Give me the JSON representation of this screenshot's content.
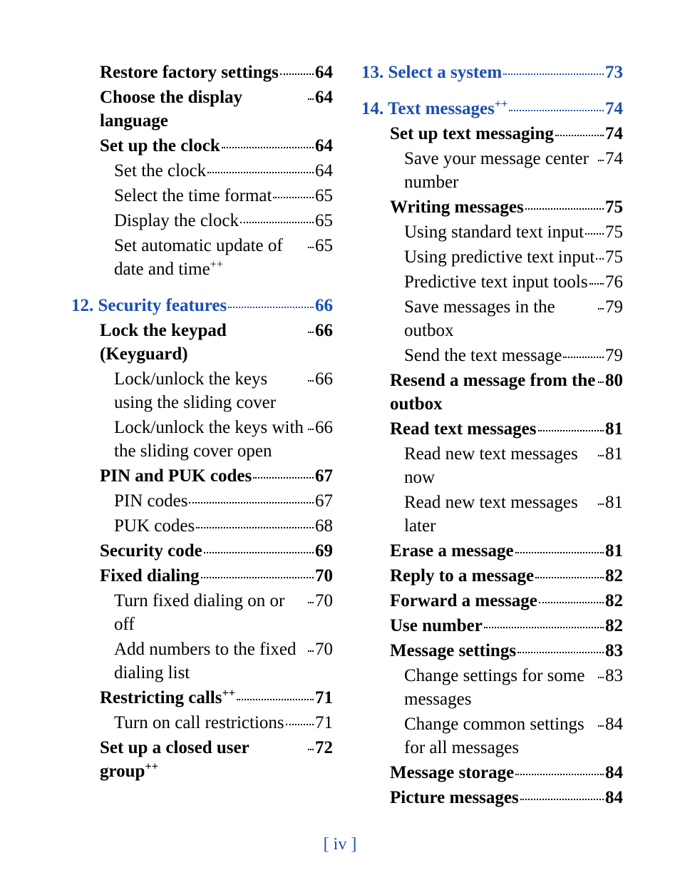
{
  "footer": "[ iv ]",
  "toc": [
    {
      "label": "Restore factory settings",
      "suffix": "",
      "page": "64",
      "level": 1,
      "style": "bold"
    },
    {
      "label": "Choose the display language",
      "suffix": "",
      "page": "64",
      "level": 1,
      "style": "bold"
    },
    {
      "label": "Set up the clock",
      "suffix": "",
      "page": "64",
      "level": 1,
      "style": "bold"
    },
    {
      "label": "Set the clock",
      "suffix": "",
      "page": "64",
      "level": 2,
      "style": "normal"
    },
    {
      "label": "Select the time format",
      "suffix": "",
      "page": "65",
      "level": 2,
      "style": "normal"
    },
    {
      "label": "Display the clock",
      "suffix": "",
      "page": "65",
      "level": 2,
      "style": "normal"
    },
    {
      "label": "Set automatic update of date and time",
      "suffix": "++",
      "page": "65",
      "level": 2,
      "style": "normal"
    },
    {
      "label": "12. Security features",
      "suffix": "",
      "page": "66",
      "level": 0,
      "style": "chapter"
    },
    {
      "label": "Lock the keypad (Keyguard)",
      "suffix": "",
      "page": "66",
      "level": 1,
      "style": "bold"
    },
    {
      "label": "Lock/unlock the keys using the sliding cover",
      "suffix": "",
      "page": "66",
      "level": 2,
      "style": "normal"
    },
    {
      "label": "Lock/unlock the keys with the sliding cover open",
      "suffix": "",
      "page": "66",
      "level": 2,
      "style": "normal"
    },
    {
      "label": "PIN and PUK codes",
      "suffix": "",
      "page": "67",
      "level": 1,
      "style": "bold"
    },
    {
      "label": "PIN codes",
      "suffix": "",
      "page": "67",
      "level": 2,
      "style": "normal"
    },
    {
      "label": "PUK codes",
      "suffix": "",
      "page": "68",
      "level": 2,
      "style": "normal"
    },
    {
      "label": "Security code",
      "suffix": "",
      "page": "69",
      "level": 1,
      "style": "bold"
    },
    {
      "label": "Fixed dialing",
      "suffix": "",
      "page": "70",
      "level": 1,
      "style": "bold"
    },
    {
      "label": "Turn fixed dialing on or off",
      "suffix": "",
      "page": "70",
      "level": 2,
      "style": "normal"
    },
    {
      "label": "Add numbers to the fixed dialing list",
      "suffix": "",
      "page": "70",
      "level": 2,
      "style": "normal"
    },
    {
      "label": "Restricting calls",
      "suffix": "++",
      "page": "71",
      "level": 1,
      "style": "bold"
    },
    {
      "label": "Turn on call restrictions",
      "suffix": "",
      "page": "71",
      "level": 2,
      "style": "normal"
    },
    {
      "label": "Set up a closed user group",
      "suffix": "++",
      "page": "72",
      "level": 1,
      "style": "bold"
    },
    {
      "label": "13. Select a system",
      "suffix": "",
      "page": "73",
      "level": 0,
      "style": "chapter"
    },
    {
      "label": "14. Text messages",
      "suffix": "++",
      "page": "74",
      "level": 0,
      "style": "chapter"
    },
    {
      "label": "Set up text messaging",
      "suffix": "",
      "page": "74",
      "level": 1,
      "style": "bold"
    },
    {
      "label": "Save your message center number",
      "suffix": "",
      "page": "74",
      "level": 2,
      "style": "normal"
    },
    {
      "label": "Writing messages",
      "suffix": "",
      "page": "75",
      "level": 1,
      "style": "bold"
    },
    {
      "label": "Using standard text input",
      "suffix": "",
      "page": "75",
      "level": 2,
      "style": "normal"
    },
    {
      "label": "Using predictive text input",
      "suffix": "",
      "page": "75",
      "level": 2,
      "style": "normal"
    },
    {
      "label": "Predictive text input tools",
      "suffix": "",
      "page": "76",
      "level": 2,
      "style": "normal"
    },
    {
      "label": "Save messages in the outbox",
      "suffix": "",
      "page": "79",
      "level": 2,
      "style": "normal"
    },
    {
      "label": "Send the text message",
      "suffix": "",
      "page": "79",
      "level": 2,
      "style": "normal"
    },
    {
      "label": "Resend a message from the outbox",
      "suffix": "",
      "page": "80",
      "level": 1,
      "style": "bold"
    },
    {
      "label": "Read text messages",
      "suffix": "",
      "page": "81",
      "level": 1,
      "style": "bold"
    },
    {
      "label": "Read new text messages now",
      "suffix": "",
      "page": "81",
      "level": 2,
      "style": "normal"
    },
    {
      "label": "Read new text messages later",
      "suffix": "",
      "page": "81",
      "level": 2,
      "style": "normal"
    },
    {
      "label": "Erase a message",
      "suffix": "",
      "page": "81",
      "level": 1,
      "style": "bold"
    },
    {
      "label": "Reply to a message",
      "suffix": "",
      "page": "82",
      "level": 1,
      "style": "bold"
    },
    {
      "label": "Forward a message",
      "suffix": "",
      "page": "82",
      "level": 1,
      "style": "bold"
    },
    {
      "label": "Use number",
      "suffix": "",
      "page": "82",
      "level": 1,
      "style": "bold"
    },
    {
      "label": "Message settings",
      "suffix": "",
      "page": "83",
      "level": 1,
      "style": "bold"
    },
    {
      "label": "Change settings for some messages",
      "suffix": "",
      "page": "83",
      "level": 2,
      "style": "normal"
    },
    {
      "label": "Change common settings for all messages",
      "suffix": "",
      "page": "84",
      "level": 2,
      "style": "normal"
    },
    {
      "label": "Message storage",
      "suffix": "",
      "page": "84",
      "level": 1,
      "style": "bold"
    },
    {
      "label": "Picture messages",
      "suffix": "",
      "page": "84",
      "level": 1,
      "style": "bold"
    }
  ]
}
